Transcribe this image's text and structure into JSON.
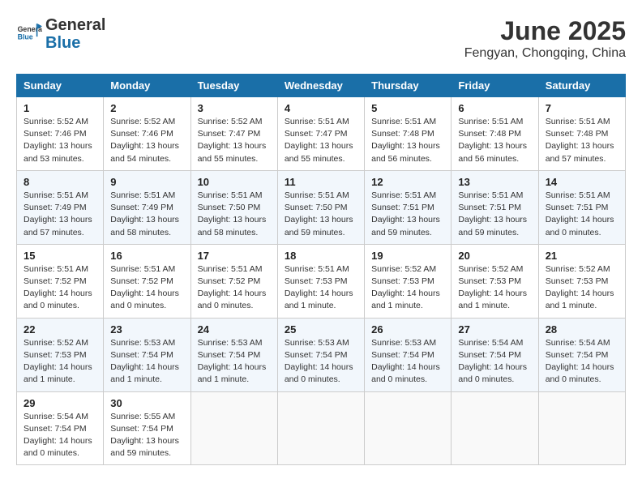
{
  "header": {
    "logo_line1": "General",
    "logo_line2": "Blue",
    "month": "June 2025",
    "location": "Fengyan, Chongqing, China"
  },
  "weekdays": [
    "Sunday",
    "Monday",
    "Tuesday",
    "Wednesday",
    "Thursday",
    "Friday",
    "Saturday"
  ],
  "weeks": [
    [
      {
        "day": "1",
        "sunrise": "5:52 AM",
        "sunset": "7:46 PM",
        "daylight": "13 hours and 53 minutes."
      },
      {
        "day": "2",
        "sunrise": "5:52 AM",
        "sunset": "7:46 PM",
        "daylight": "13 hours and 54 minutes."
      },
      {
        "day": "3",
        "sunrise": "5:52 AM",
        "sunset": "7:47 PM",
        "daylight": "13 hours and 55 minutes."
      },
      {
        "day": "4",
        "sunrise": "5:51 AM",
        "sunset": "7:47 PM",
        "daylight": "13 hours and 55 minutes."
      },
      {
        "day": "5",
        "sunrise": "5:51 AM",
        "sunset": "7:48 PM",
        "daylight": "13 hours and 56 minutes."
      },
      {
        "day": "6",
        "sunrise": "5:51 AM",
        "sunset": "7:48 PM",
        "daylight": "13 hours and 56 minutes."
      },
      {
        "day": "7",
        "sunrise": "5:51 AM",
        "sunset": "7:48 PM",
        "daylight": "13 hours and 57 minutes."
      }
    ],
    [
      {
        "day": "8",
        "sunrise": "5:51 AM",
        "sunset": "7:49 PM",
        "daylight": "13 hours and 57 minutes."
      },
      {
        "day": "9",
        "sunrise": "5:51 AM",
        "sunset": "7:49 PM",
        "daylight": "13 hours and 58 minutes."
      },
      {
        "day": "10",
        "sunrise": "5:51 AM",
        "sunset": "7:50 PM",
        "daylight": "13 hours and 58 minutes."
      },
      {
        "day": "11",
        "sunrise": "5:51 AM",
        "sunset": "7:50 PM",
        "daylight": "13 hours and 59 minutes."
      },
      {
        "day": "12",
        "sunrise": "5:51 AM",
        "sunset": "7:51 PM",
        "daylight": "13 hours and 59 minutes."
      },
      {
        "day": "13",
        "sunrise": "5:51 AM",
        "sunset": "7:51 PM",
        "daylight": "13 hours and 59 minutes."
      },
      {
        "day": "14",
        "sunrise": "5:51 AM",
        "sunset": "7:51 PM",
        "daylight": "14 hours and 0 minutes."
      }
    ],
    [
      {
        "day": "15",
        "sunrise": "5:51 AM",
        "sunset": "7:52 PM",
        "daylight": "14 hours and 0 minutes."
      },
      {
        "day": "16",
        "sunrise": "5:51 AM",
        "sunset": "7:52 PM",
        "daylight": "14 hours and 0 minutes."
      },
      {
        "day": "17",
        "sunrise": "5:51 AM",
        "sunset": "7:52 PM",
        "daylight": "14 hours and 0 minutes."
      },
      {
        "day": "18",
        "sunrise": "5:51 AM",
        "sunset": "7:53 PM",
        "daylight": "14 hours and 1 minute."
      },
      {
        "day": "19",
        "sunrise": "5:52 AM",
        "sunset": "7:53 PM",
        "daylight": "14 hours and 1 minute."
      },
      {
        "day": "20",
        "sunrise": "5:52 AM",
        "sunset": "7:53 PM",
        "daylight": "14 hours and 1 minute."
      },
      {
        "day": "21",
        "sunrise": "5:52 AM",
        "sunset": "7:53 PM",
        "daylight": "14 hours and 1 minute."
      }
    ],
    [
      {
        "day": "22",
        "sunrise": "5:52 AM",
        "sunset": "7:53 PM",
        "daylight": "14 hours and 1 minute."
      },
      {
        "day": "23",
        "sunrise": "5:53 AM",
        "sunset": "7:54 PM",
        "daylight": "14 hours and 1 minute."
      },
      {
        "day": "24",
        "sunrise": "5:53 AM",
        "sunset": "7:54 PM",
        "daylight": "14 hours and 1 minute."
      },
      {
        "day": "25",
        "sunrise": "5:53 AM",
        "sunset": "7:54 PM",
        "daylight": "14 hours and 0 minutes."
      },
      {
        "day": "26",
        "sunrise": "5:53 AM",
        "sunset": "7:54 PM",
        "daylight": "14 hours and 0 minutes."
      },
      {
        "day": "27",
        "sunrise": "5:54 AM",
        "sunset": "7:54 PM",
        "daylight": "14 hours and 0 minutes."
      },
      {
        "day": "28",
        "sunrise": "5:54 AM",
        "sunset": "7:54 PM",
        "daylight": "14 hours and 0 minutes."
      }
    ],
    [
      {
        "day": "29",
        "sunrise": "5:54 AM",
        "sunset": "7:54 PM",
        "daylight": "14 hours and 0 minutes."
      },
      {
        "day": "30",
        "sunrise": "5:55 AM",
        "sunset": "7:54 PM",
        "daylight": "13 hours and 59 minutes."
      },
      null,
      null,
      null,
      null,
      null
    ]
  ],
  "labels": {
    "sunrise": "Sunrise: ",
    "sunset": "Sunset: ",
    "daylight": "Daylight: "
  }
}
